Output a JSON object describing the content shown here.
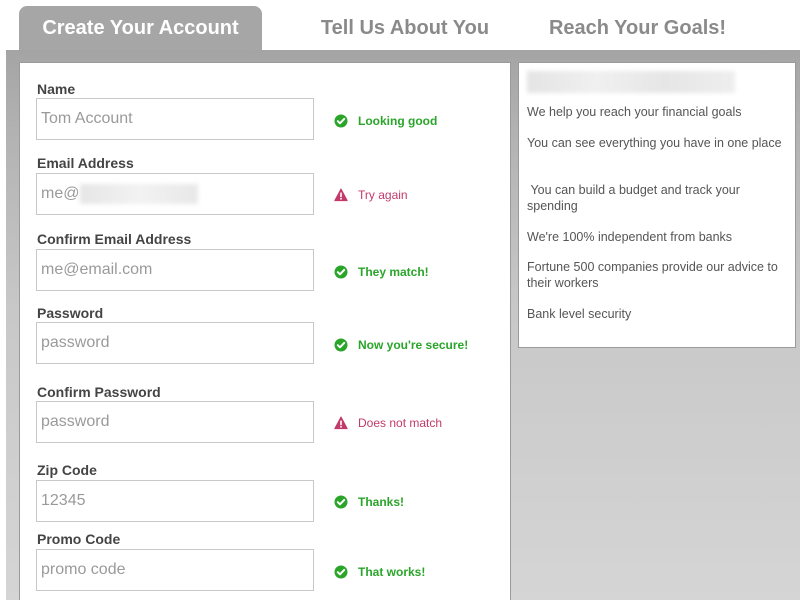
{
  "tabs": [
    {
      "label": "Create Your Account",
      "active": true
    },
    {
      "label": "Tell Us About You",
      "active": false
    },
    {
      "label": "Reach Your Goals!",
      "active": false
    }
  ],
  "form": {
    "fields": [
      {
        "label": "Name",
        "value": "Tom Account",
        "status": "Looking good",
        "status_type": "ok"
      },
      {
        "label": "Email Address",
        "value": "me@",
        "status": "Try again",
        "status_type": "error"
      },
      {
        "label": "Confirm Email Address",
        "value": "me@email.com",
        "status": "They match!",
        "status_type": "ok"
      },
      {
        "label": "Password",
        "value": "password",
        "status": "Now you're secure!",
        "status_type": "ok"
      },
      {
        "label": "Confirm Password",
        "value": "password",
        "status": "Does not match",
        "status_type": "error"
      },
      {
        "label": "Zip Code",
        "value": "12345",
        "status": "Thanks!",
        "status_type": "ok"
      },
      {
        "label": "Promo Code",
        "value": "promo code",
        "status": "That works!",
        "status_type": "ok"
      }
    ]
  },
  "info": {
    "items": [
      "We help you reach your financial goals",
      "You can see everything you have in one place",
      " You can build a budget and track your spending",
      "We're 100% independent from banks",
      "Fortune 500 companies provide our advice to their workers",
      "Bank level security"
    ]
  },
  "colors": {
    "ok": "#2aa52a",
    "error": "#c23a6a",
    "tab_active_bg": "#a6a6a6"
  },
  "icons": {
    "ok": "check-circle-icon",
    "error": "warning-triangle-icon"
  }
}
